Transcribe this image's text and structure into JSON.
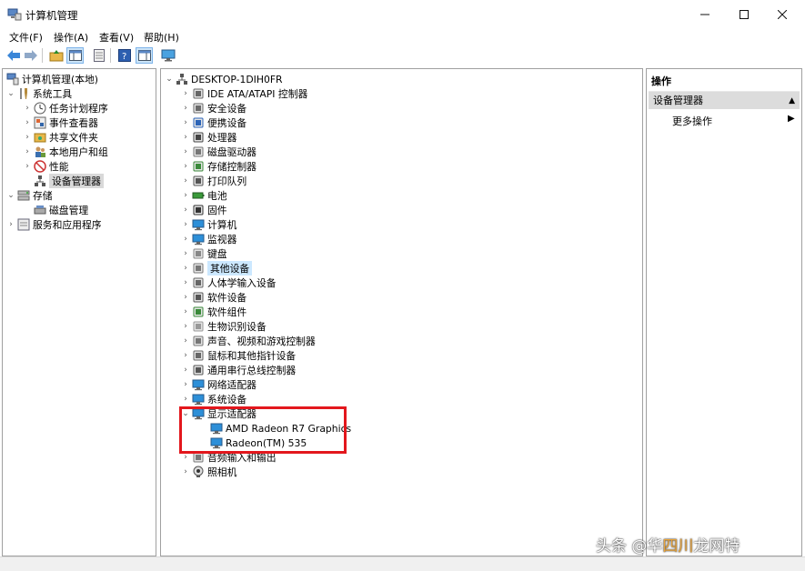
{
  "window": {
    "title": "计算机管理",
    "minimize_icon": "minimize-icon",
    "maximize_icon": "maximize-icon",
    "close_icon": "close-icon"
  },
  "menu": [
    "文件(F)",
    "操作(A)",
    "查看(V)",
    "帮助(H)"
  ],
  "toolbar": [
    "back-arrow-icon",
    "forward-arrow-icon",
    "up-folder-icon",
    "show-hide-tree-icon",
    "properties-icon",
    "help-icon",
    "console-tree-icon",
    "monitor-icon"
  ],
  "left_tree": {
    "root": "计算机管理(本地)",
    "system_tools": "系统工具",
    "task_scheduler": "任务计划程序",
    "event_viewer": "事件查看器",
    "shared_folders": "共享文件夹",
    "local_users": "本地用户和组",
    "performance": "性能",
    "device_manager": "设备管理器",
    "storage": "存储",
    "disk_management": "磁盘管理",
    "services_apps": "服务和应用程序"
  },
  "device_tree": {
    "root": "DESKTOP-1DIH0FR",
    "categories": [
      {
        "label": "IDE ATA/ATAPI 控制器",
        "icon": "ide-controller-icon"
      },
      {
        "label": "安全设备",
        "icon": "security-device-icon"
      },
      {
        "label": "便携设备",
        "icon": "portable-device-icon"
      },
      {
        "label": "处理器",
        "icon": "processor-icon"
      },
      {
        "label": "磁盘驱动器",
        "icon": "disk-drive-icon"
      },
      {
        "label": "存储控制器",
        "icon": "storage-controller-icon"
      },
      {
        "label": "打印队列",
        "icon": "printer-icon"
      },
      {
        "label": "电池",
        "icon": "battery-icon"
      },
      {
        "label": "固件",
        "icon": "firmware-icon"
      },
      {
        "label": "计算机",
        "icon": "computer-icon"
      },
      {
        "label": "监视器",
        "icon": "monitor-icon"
      },
      {
        "label": "键盘",
        "icon": "keyboard-icon"
      },
      {
        "label": "其他设备",
        "icon": "other-device-icon"
      },
      {
        "label": "人体学输入设备",
        "icon": "hid-icon"
      },
      {
        "label": "软件设备",
        "icon": "software-device-icon"
      },
      {
        "label": "软件组件",
        "icon": "software-component-icon"
      },
      {
        "label": "生物识别设备",
        "icon": "biometric-icon"
      },
      {
        "label": "声音、视频和游戏控制器",
        "icon": "sound-icon"
      },
      {
        "label": "鼠标和其他指针设备",
        "icon": "mouse-icon"
      },
      {
        "label": "通用串行总线控制器",
        "icon": "usb-icon"
      },
      {
        "label": "网络适配器",
        "icon": "network-adapter-icon"
      },
      {
        "label": "系统设备",
        "icon": "system-device-icon"
      },
      {
        "label": "显示适配器",
        "icon": "display-adapter-icon"
      },
      {
        "label": "AMD Radeon R7 Graphics",
        "icon": "display-adapter-icon"
      },
      {
        "label": "Radeon(TM) 535",
        "icon": "display-adapter-icon"
      },
      {
        "label": "音频输入和输出",
        "icon": "audio-io-icon"
      },
      {
        "label": "照相机",
        "icon": "camera-icon"
      }
    ]
  },
  "actions": {
    "header": "操作",
    "section": "设备管理器",
    "more": "更多操作"
  },
  "watermark": {
    "prefix": "头条 @华",
    "accent": "四川",
    "suffix": "龙网特"
  },
  "colors": {
    "highlight_border": "#e3171d",
    "selection_blue": "#cce8ff",
    "selection_gray": "#d9d9d9"
  }
}
